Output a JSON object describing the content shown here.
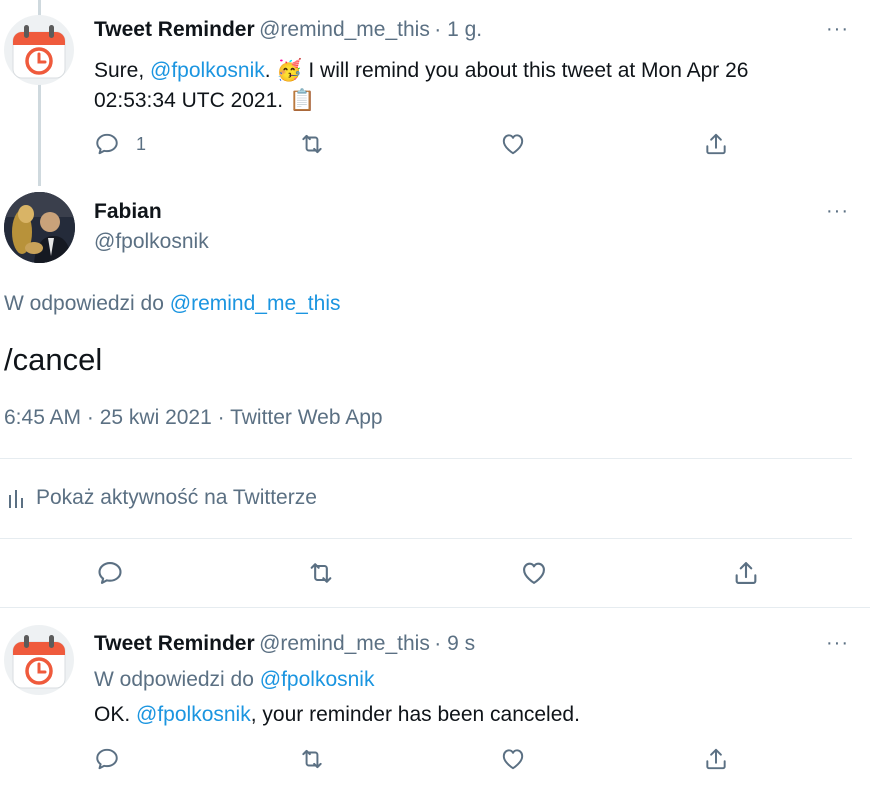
{
  "tweet1": {
    "name": "Tweet Reminder",
    "handle": "@remind_me_this",
    "time": "· 1 g.",
    "text_pre": "Sure, ",
    "mention": "@fpolkosnik",
    "text_mid": ". 🥳 I will remind you about this tweet at Mon Apr 26",
    "text_line2": "02:53:34 UTC 2021. 📋",
    "reply_count": "1"
  },
  "main_tweet": {
    "name": "Fabian",
    "handle": "@fpolkosnik",
    "reply_prefix": "W odpowiedzi do ",
    "reply_to": "@remind_me_this",
    "text": "/cancel",
    "timestamp": "6:45 AM · 25 kwi 2021 · Twitter Web App",
    "activity_label": "Pokaż aktywność na Twitterze"
  },
  "tweet3": {
    "name": "Tweet Reminder",
    "handle": "@remind_me_this",
    "time": "· 9 s",
    "reply_prefix": "W odpowiedzi do ",
    "reply_to": "@fpolkosnik",
    "text_pre": "OK. ",
    "mention": "@fpolkosnik",
    "text_post": ", your reminder has  been canceled."
  },
  "more_label": "···",
  "colors": {
    "accent": "#1b95e0",
    "secondary": "#5b7083",
    "divider": "#e6ecf0",
    "reminder_icon_red": "#ef5a3c"
  }
}
